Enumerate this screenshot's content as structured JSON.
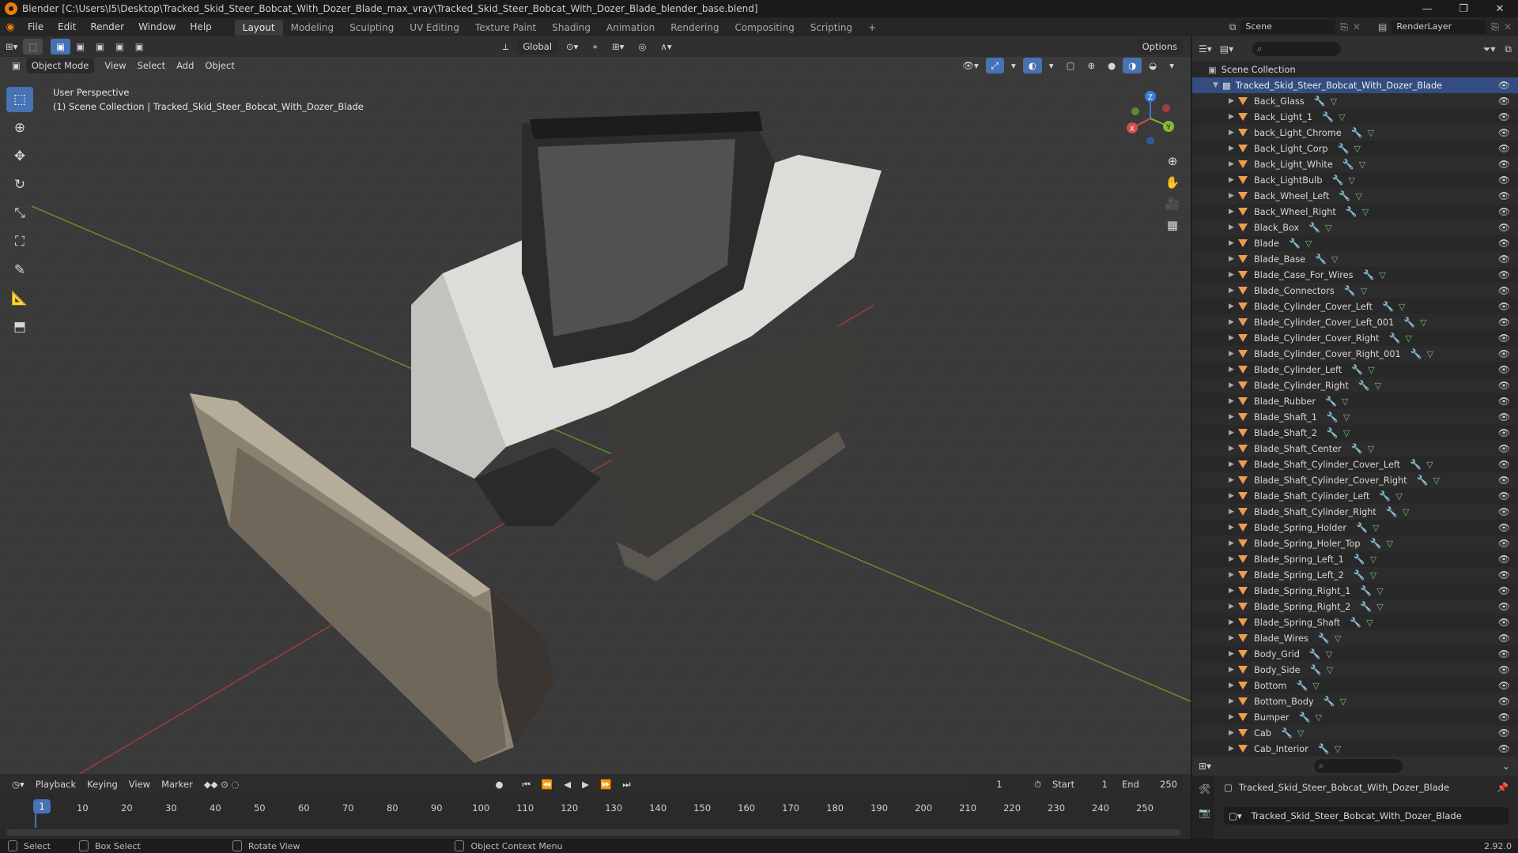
{
  "window": {
    "title": "Blender [C:\\Users\\I5\\Desktop\\Tracked_Skid_Steer_Bobcat_With_Dozer_Blade_max_vray\\Tracked_Skid_Steer_Bobcat_With_Dozer_Blade_blender_base.blend]",
    "controls": [
      "—",
      "❐",
      "✕"
    ]
  },
  "menus": [
    "File",
    "Edit",
    "Render",
    "Window",
    "Help"
  ],
  "workspaces": [
    "Layout",
    "Modeling",
    "Sculpting",
    "UV Editing",
    "Texture Paint",
    "Shading",
    "Animation",
    "Rendering",
    "Compositing",
    "Scripting"
  ],
  "workspace_add": "+",
  "scene": {
    "name": "Scene",
    "render_layer": "RenderLayer"
  },
  "header": {
    "transform_orientation": "Global",
    "options": "Options"
  },
  "viewport_header": {
    "mode": "Object Mode",
    "items": [
      "View",
      "Select",
      "Add",
      "Object"
    ]
  },
  "viewport": {
    "perspective": "User Perspective",
    "collection_info": "(1) Scene Collection | Tracked_Skid_Steer_Bobcat_With_Dozer_Blade",
    "gizmo": {
      "x": "X",
      "y": "Y",
      "z": "Z"
    }
  },
  "outliner": {
    "root": "Scene Collection",
    "collection": "Tracked_Skid_Steer_Bobcat_With_Dozer_Blade",
    "objects": [
      "Back_Glass",
      "Back_Light_1",
      "back_Light_Chrome",
      "Back_Light_Corp",
      "Back_Light_White",
      "Back_LightBulb",
      "Back_Wheel_Left",
      "Back_Wheel_Right",
      "Black_Box",
      "Blade",
      "Blade_Base",
      "Blade_Case_For_Wires",
      "Blade_Connectors",
      "Blade_Cylinder_Cover_Left",
      "Blade_Cylinder_Cover_Left_001",
      "Blade_Cylinder_Cover_Right",
      "Blade_Cylinder_Cover_Right_001",
      "Blade_Cylinder_Left",
      "Blade_Cylinder_Right",
      "Blade_Rubber",
      "Blade_Shaft_1",
      "Blade_Shaft_2",
      "Blade_Shaft_Center",
      "Blade_Shaft_Cylinder_Cover_Left",
      "Blade_Shaft_Cylinder_Cover_Right",
      "Blade_Shaft_Cylinder_Left",
      "Blade_Shaft_Cylinder_Right",
      "Blade_Spring_Holder",
      "Blade_Spring_Holer_Top",
      "Blade_Spring_Left_1",
      "Blade_Spring_Left_2",
      "Blade_Spring_Right_1",
      "Blade_Spring_Right_2",
      "Blade_Spring_Shaft",
      "Blade_Wires",
      "Body_Grid",
      "Body_Side",
      "Bottom",
      "Bottom_Body",
      "Bumper",
      "Cab",
      "Cab_Interior"
    ]
  },
  "properties": {
    "object_name": "Tracked_Skid_Steer_Bobcat_With_Dozer_Blade",
    "data_name": "Tracked_Skid_Steer_Bobcat_With_Dozer_Blade"
  },
  "timeline": {
    "menus": [
      "Playback",
      "Keying",
      "View",
      "Marker"
    ],
    "current_frame": "1",
    "start_label": "Start",
    "start": "1",
    "end_label": "End",
    "end": "250",
    "ticks": [
      "1",
      "10",
      "20",
      "30",
      "40",
      "50",
      "60",
      "70",
      "80",
      "90",
      "100",
      "110",
      "120",
      "130",
      "140",
      "150",
      "160",
      "170",
      "180",
      "190",
      "200",
      "210",
      "220",
      "230",
      "240",
      "250"
    ]
  },
  "statusbar": {
    "items": [
      "Select",
      "Box Select",
      "Rotate View",
      "Object Context Menu"
    ],
    "version": "2.92.0"
  }
}
